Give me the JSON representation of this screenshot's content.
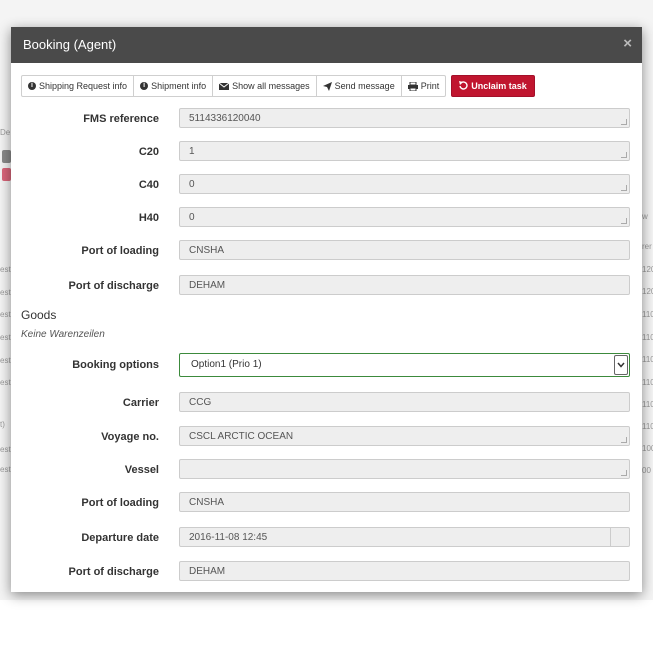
{
  "modal": {
    "title": "Booking (Agent)",
    "close_glyph": "×"
  },
  "toolbar": {
    "shipping_request_info": "Shipping Request info",
    "shipment_info": "Shipment info",
    "show_all_messages": "Show all messages",
    "send_message": "Send message",
    "print": "Print",
    "unclaim_task": "Unclaim task",
    "unclaim_color": "#c0152f"
  },
  "form": {
    "fms_reference": {
      "label": "FMS reference",
      "value": "5114336120040"
    },
    "c20": {
      "label": "C20",
      "value": "1"
    },
    "c40": {
      "label": "C40",
      "value": "0"
    },
    "h40": {
      "label": "H40",
      "value": "0"
    },
    "port_of_loading": {
      "label": "Port of loading",
      "value": "CNSHA"
    },
    "port_of_discharge": {
      "label": "Port of discharge",
      "value": "DEHAM"
    }
  },
  "goods": {
    "title": "Goods",
    "empty_text": "Keine Warenzeilen"
  },
  "booking": {
    "options": {
      "label": "Booking options",
      "selected": "Option1 (Prio 1)"
    },
    "carrier": {
      "label": "Carrier",
      "value": "CCG"
    },
    "voyage_no": {
      "label": "Voyage no.",
      "value": "CSCL ARCTIC OCEAN"
    },
    "vessel": {
      "label": "Vessel",
      "value": ""
    },
    "port_of_loading": {
      "label": "Port of loading",
      "value": "CNSHA"
    },
    "departure_date": {
      "label": "Departure date",
      "value": "2016-11-08 12:45"
    },
    "port_of_discharge": {
      "label": "Port of discharge",
      "value": "DEHAM"
    }
  },
  "background": {
    "left_fragments": [
      "De",
      "est",
      "est",
      "est",
      "est",
      "est",
      "est",
      "t)",
      "est",
      "est"
    ],
    "right_fragments": [
      "w",
      "rer",
      "120",
      "120",
      "110",
      "110",
      "110",
      "110",
      "110",
      "110",
      "100",
      "00"
    ],
    "chip_colors": [
      "#8a8a8a",
      "#d9667a"
    ]
  },
  "icons": {
    "info": "info-circle-icon",
    "envelope": "envelope-icon",
    "send": "paper-plane-icon",
    "print": "print-icon",
    "undo": "undo-icon",
    "chevron": "chevron-down-icon"
  }
}
